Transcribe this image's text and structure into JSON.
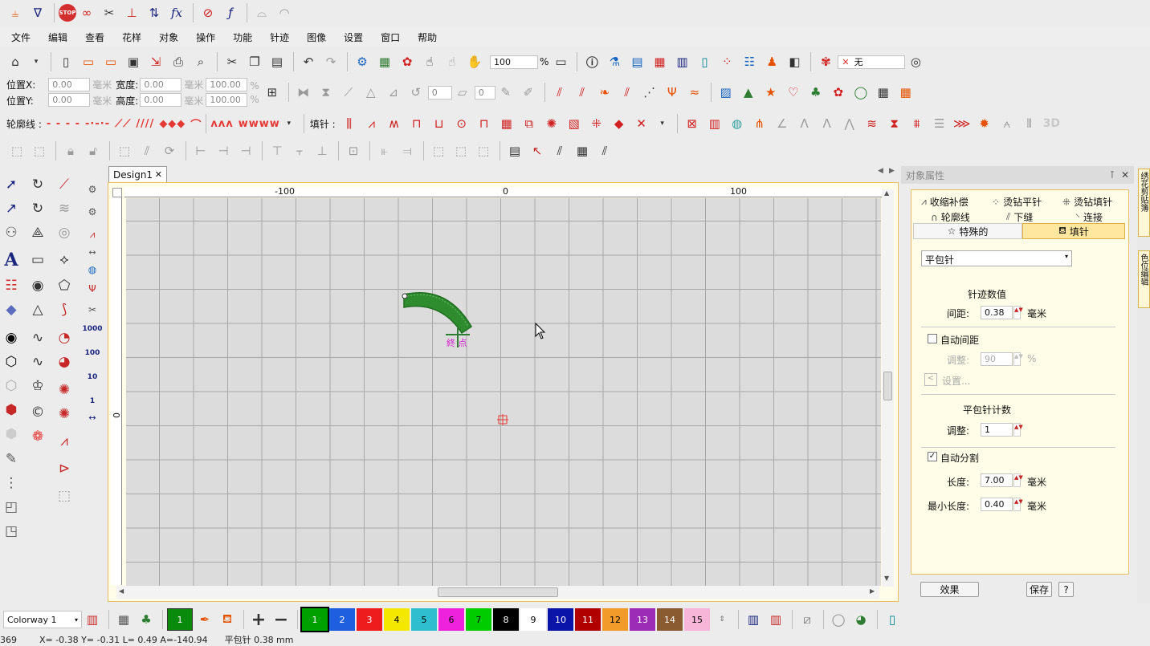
{
  "menu": [
    "文件",
    "编辑",
    "查看",
    "花样",
    "对象",
    "操作",
    "功能",
    "针迹",
    "图像",
    "设置",
    "窗口",
    "帮助"
  ],
  "toolbar1": {
    "stop_label": "STOP",
    "fx_label": "fx"
  },
  "toolbar2": {
    "zoom_value": "100",
    "zoom_unit": "%",
    "colorway_fabric": "无"
  },
  "toolbar3": {
    "pos_x_label": "位置X:",
    "pos_y_label": "位置Y:",
    "pos_x_value": "0.00",
    "pos_y_value": "0.00",
    "width_label": "宽度:",
    "height_label": "高度:",
    "width_value": "0.00",
    "height_value": "0.00",
    "unit_mm": "毫米",
    "unit_pct": "%",
    "width_pct": "100.00",
    "height_pct": "100.00",
    "rotate_value": "0",
    "skew_value": "0"
  },
  "toolbar4": {
    "outline_label": "轮廓线 :",
    "fill_label": "填针 :",
    "badge_3d": "3D"
  },
  "document": {
    "tab_title": "Design1",
    "ruler_h": [
      "-100",
      "0",
      "100"
    ],
    "ruler_v": [
      "0"
    ],
    "end_label": "終 点"
  },
  "panel": {
    "title": "对象属性",
    "tabs_row1": [
      "收缩补偿",
      "烫钻平针",
      "烫钻填针"
    ],
    "tabs_row2": [
      "轮廓线",
      "下缝",
      "连接"
    ],
    "tabs_row3": [
      "特殊的",
      "填针"
    ],
    "stitch_type": "平包针",
    "section_density": "针迹数值",
    "spacing_label": "间距:",
    "spacing_value": "0.38",
    "unit_mm": "毫米",
    "auto_spacing_label": "自动间距",
    "adjust_label": "调整:",
    "adjust_value": "90",
    "adjust_unit": "%",
    "settings_label": "设置...",
    "section_count": "平包针计数",
    "count_adjust_label": "调整:",
    "count_adjust_value": "1",
    "auto_split_label": "自动分割",
    "length_label": "长度:",
    "length_value": "7.00",
    "min_length_label": "最小长度:",
    "min_length_value": "0.40",
    "effect_button": "效果",
    "save_button": "保存",
    "help_button": "?"
  },
  "side_tabs": [
    "绣花剪贴簿",
    "色位编辑"
  ],
  "bottom": {
    "colorway": "Colorway 1",
    "current_color": "1",
    "swatches": [
      {
        "n": "1",
        "c": "#00a000",
        "t": "#ffffff"
      },
      {
        "n": "2",
        "c": "#1e5fe0",
        "t": "#ffffff"
      },
      {
        "n": "3",
        "c": "#ee1c1c",
        "t": "#ffffff"
      },
      {
        "n": "4",
        "c": "#f5e800",
        "t": "#000000"
      },
      {
        "n": "5",
        "c": "#2fbdd0",
        "t": "#000000"
      },
      {
        "n": "6",
        "c": "#ee22dd",
        "t": "#000000"
      },
      {
        "n": "7",
        "c": "#00cc00",
        "t": "#000000"
      },
      {
        "n": "8",
        "c": "#000000",
        "t": "#ffffff"
      },
      {
        "n": "9",
        "c": "#ffffff",
        "t": "#000000"
      },
      {
        "n": "10",
        "c": "#0a14a8",
        "t": "#ffffff"
      },
      {
        "n": "11",
        "c": "#b00000",
        "t": "#ffffff"
      },
      {
        "n": "12",
        "c": "#f29a2a",
        "t": "#000000"
      },
      {
        "n": "13",
        "c": "#9c2bb5",
        "t": "#ffffff"
      },
      {
        "n": "14",
        "c": "#8a5a30",
        "t": "#ffffff"
      },
      {
        "n": "15",
        "c": "#f7b6d8",
        "t": "#000000"
      }
    ]
  },
  "status": {
    "text": "369        X= -0.38 Y= -0.31 L= 0.49 A=-140.94      平包针 0.38 mm"
  }
}
